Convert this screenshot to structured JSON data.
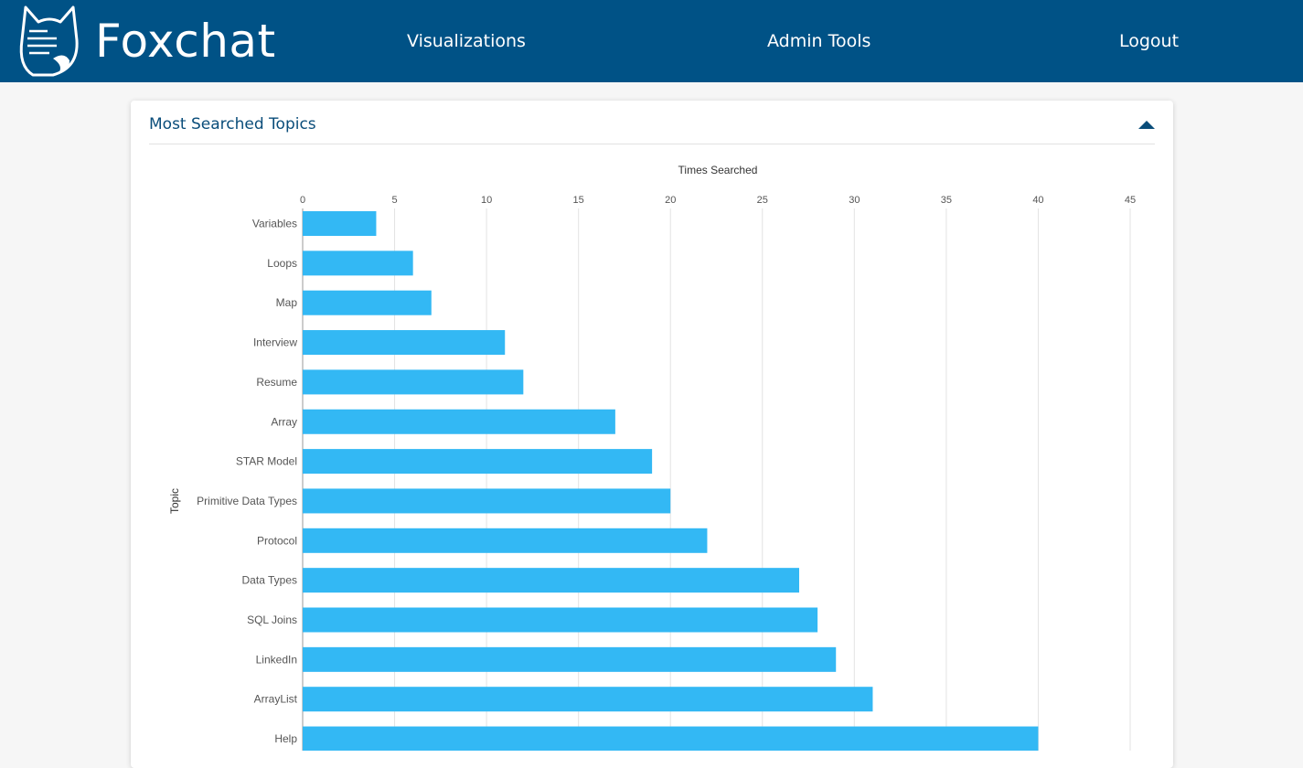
{
  "navbar": {
    "brand": "Foxchat",
    "logo_icon": "fox-logo-icon",
    "links": [
      "Visualizations",
      "Admin Tools",
      "Logout"
    ],
    "background_color": "#005286"
  },
  "panel": {
    "title": "Most Searched Topics",
    "collapse_icon": "caret-up-icon"
  },
  "chart_data": {
    "type": "bar",
    "orientation": "horizontal",
    "xlabel": "Times Searched",
    "ylabel": "Topic",
    "xlim": [
      0,
      45
    ],
    "xticks": [
      0,
      5,
      10,
      15,
      20,
      25,
      30,
      35,
      40,
      45
    ],
    "x_axis_position": "top",
    "grid": true,
    "bar_color": "#33b8f4",
    "categories": [
      "Variables",
      "Loops",
      "Map",
      "Interview",
      "Resume",
      "Array",
      "STAR Model",
      "Primitive Data Types",
      "Protocol",
      "Data Types",
      "SQL Joins",
      "LinkedIn",
      "ArrayList",
      "Help"
    ],
    "values": [
      4,
      6,
      7,
      11,
      12,
      17,
      19,
      20,
      22,
      27,
      28,
      29,
      31,
      40
    ]
  }
}
